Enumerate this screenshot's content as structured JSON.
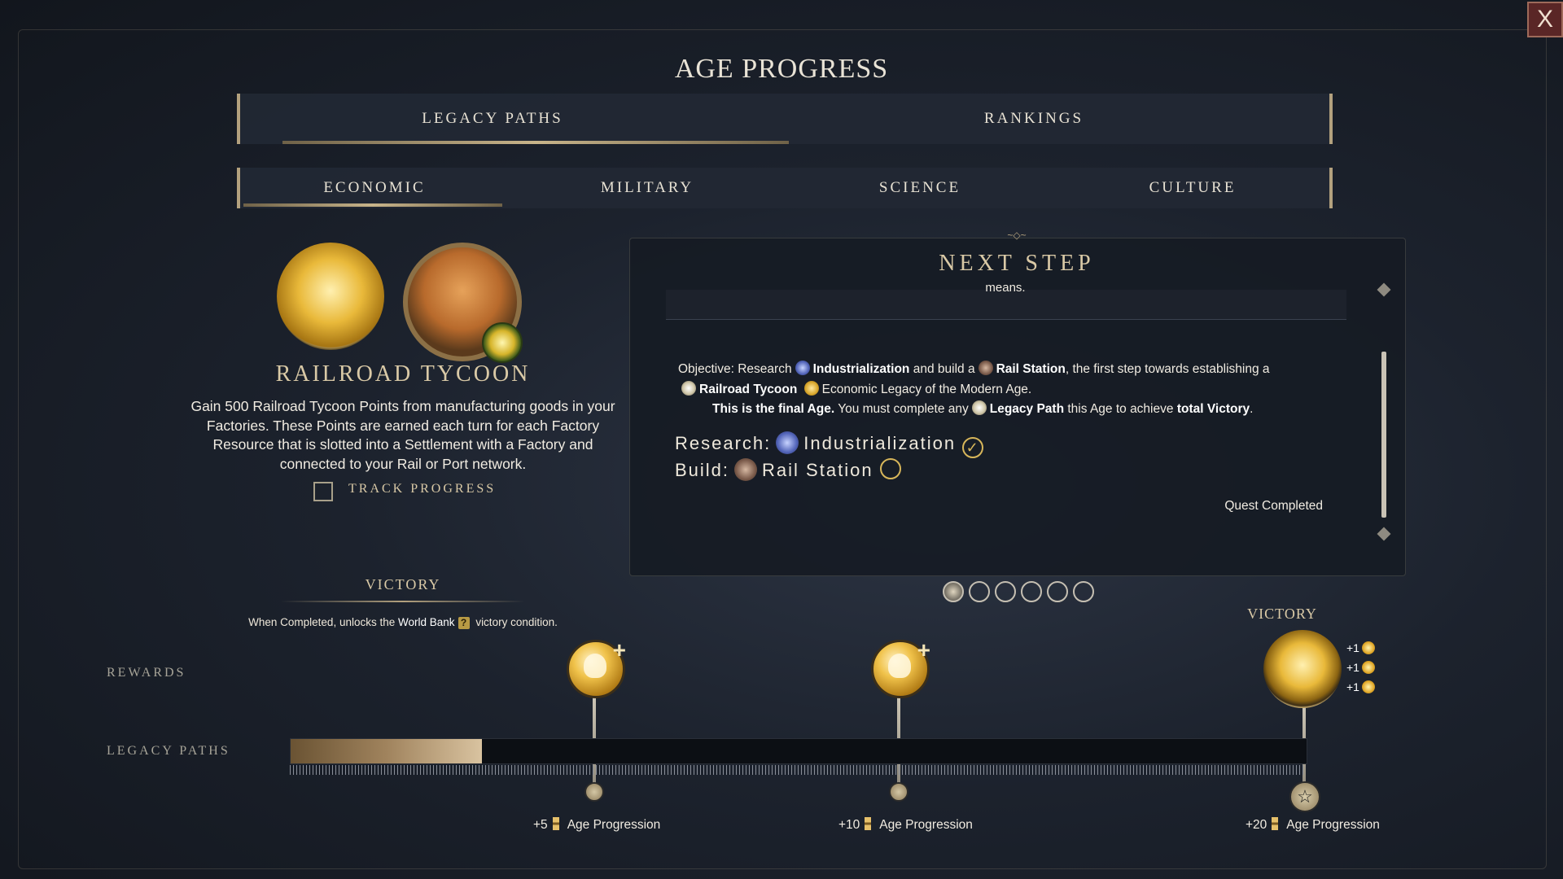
{
  "window": {
    "title": "AGE PROGRESS",
    "close_label": "X"
  },
  "main_tabs": [
    {
      "label": "LEGACY PATHS",
      "active": true
    },
    {
      "label": "RANKINGS",
      "active": false
    }
  ],
  "sub_tabs": [
    {
      "label": "ECONOMIC",
      "active": true
    },
    {
      "label": "MILITARY",
      "active": false
    },
    {
      "label": "SCIENCE",
      "active": false
    },
    {
      "label": "CULTURE",
      "active": false
    }
  ],
  "legacy_path": {
    "name": "RAILROAD TYCOON",
    "description": "Gain 500 Railroad Tycoon Points from manufacturing goods in your Factories. These Points are earned each turn for each Factory Resource that is slotted into a Settlement with a Factory and connected to your Rail or Port network.",
    "track_progress_label": "TRACK PROGRESS",
    "track_progress_checked": false
  },
  "victory": {
    "heading": "VICTORY",
    "desc_before": "When Completed, unlocks the",
    "desc_link": "World Bank",
    "desc_badge": "?",
    "desc_after": "victory condition."
  },
  "next_step": {
    "heading": "NEXT STEP",
    "prev_text": "means.",
    "obj_prefix": "Objective: Research",
    "obj_tech": "Industrialization",
    "obj_mid": "and build a",
    "obj_building": "Rail Station",
    "obj_rest": ", the first step towards establishing a",
    "obj_path": "Railroad Tycoon",
    "obj_path_rest": "Economic Legacy of the Modern Age.",
    "obj_final_bold": "This is the final Age.",
    "obj_final_mid": "You must complete any",
    "obj_final_path": "Legacy Path",
    "obj_final_after": "this Age to achieve",
    "obj_final_victory": "total Victory",
    "obj_final_end": ".",
    "req_research_label": "Research:",
    "req_research_value": "Industrialization",
    "req_research_done": true,
    "req_build_label": "Build:",
    "req_build_value": "Rail Station",
    "req_build_done": false,
    "status": "Quest Completed"
  },
  "pager": {
    "pages": 6,
    "current": 1
  },
  "victory_reward_heading": "VICTORY",
  "victory_bonuses": [
    "+1",
    "+1",
    "+1"
  ],
  "rows": {
    "rewards_label": "REWARDS",
    "legacy_label": "LEGACY PATHS"
  },
  "progress": {
    "fraction": 0.188
  },
  "milestones": [
    {
      "amount": "+5",
      "label": "Age Progression"
    },
    {
      "amount": "+10",
      "label": "Age Progression"
    },
    {
      "amount": "+20",
      "label": "Age Progression"
    }
  ],
  "colors": {
    "accent": "#d9c9a6",
    "gold": "#d7b65a",
    "close_bg": "#5a2626"
  }
}
